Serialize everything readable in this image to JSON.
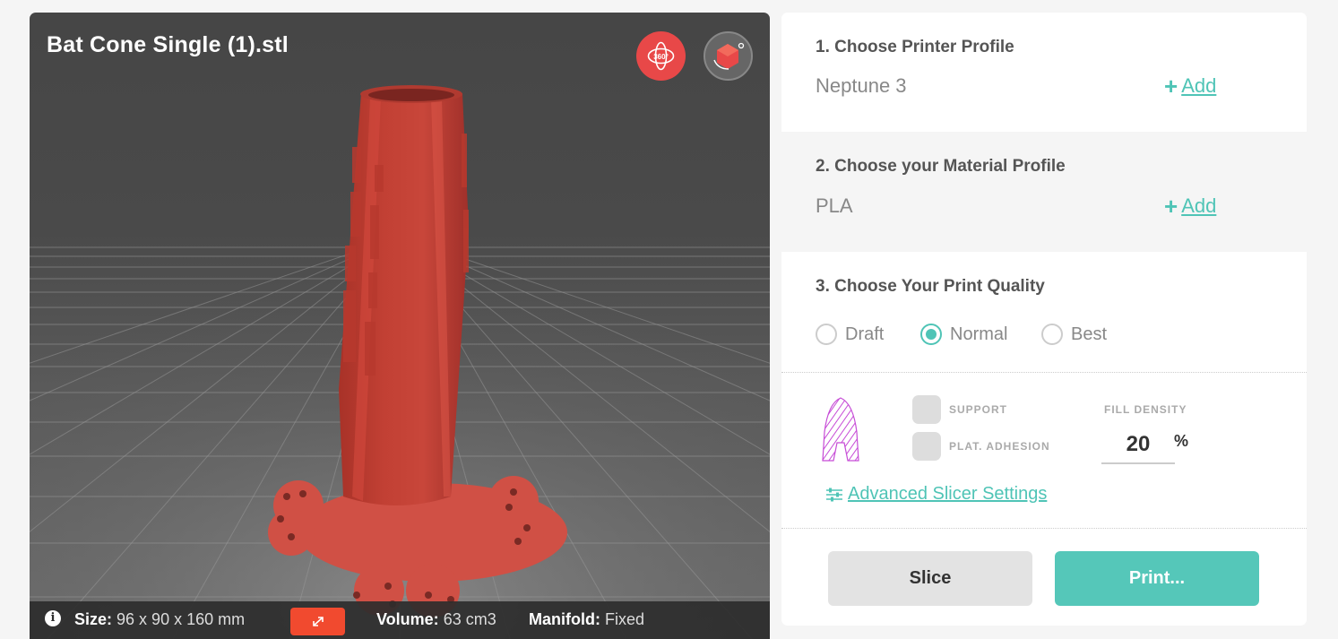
{
  "viewer": {
    "file_name": "Bat Cone Single (1).stl",
    "view_360_label": "360°",
    "info": {
      "size_label": "Size:",
      "size_value": "96 x 90 x 160 mm",
      "volume_label": "Volume:",
      "volume_value": "63 cm3",
      "manifold_label": "Manifold:",
      "manifold_value": "Fixed"
    },
    "icons": [
      "rotate-360-icon",
      "cube-view-icon",
      "info-icon",
      "resize-icon"
    ],
    "model_color": "#c8463a"
  },
  "panel": {
    "printer": {
      "title": "1. Choose Printer Profile",
      "value": "Neptune 3",
      "add_label": "Add"
    },
    "material": {
      "title": "2. Choose your Material Profile",
      "value": "PLA",
      "add_label": "Add"
    },
    "quality": {
      "title": "3. Choose Your Print Quality",
      "options": [
        "Draft",
        "Normal",
        "Best"
      ],
      "selected": "Normal"
    },
    "settings": {
      "support_label": "SUPPORT",
      "adhesion_label": "PLAT. ADHESION",
      "fill_density_label": "FILL DENSITY",
      "fill_density_value": "20",
      "fill_density_unit": "%",
      "advanced_label": "Advanced Slicer Settings"
    },
    "actions": {
      "slice_label": "Slice",
      "print_label": "Print..."
    }
  },
  "colors": {
    "accent": "#4fc4b6",
    "print_button": "#55c7b9",
    "view_button_red": "#e84848",
    "scale_button": "#f14a2f"
  }
}
